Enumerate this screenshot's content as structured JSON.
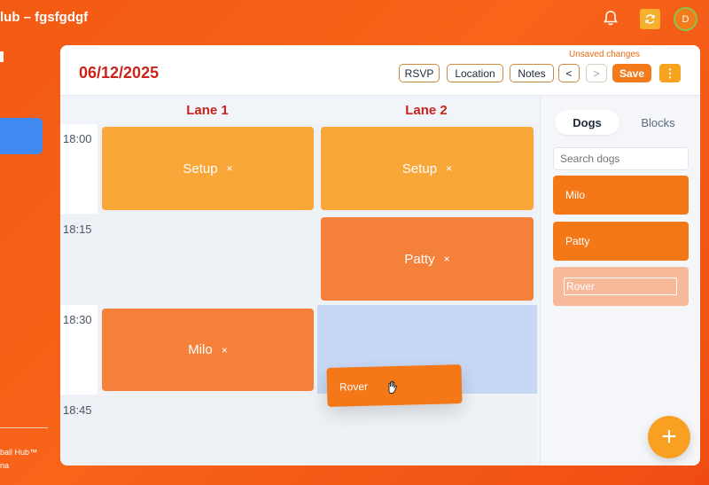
{
  "app": {
    "title": "lub – fgsfgdgf",
    "avatar_initial": "D"
  },
  "sidebar": {
    "footer_line1": "ball Hub™",
    "footer_line2": "na"
  },
  "schedule": {
    "date": "06/12/2025",
    "unsaved_text": "Unsaved changes",
    "toolbar": {
      "rsvp": "RSVP",
      "location": "Location",
      "notes": "Notes",
      "prev": "<",
      "next": ">",
      "save": "Save",
      "more": "⋮"
    },
    "lanes": [
      "Lane 1",
      "Lane 2"
    ],
    "times": [
      "18:00",
      "18:15",
      "18:30",
      "18:45"
    ],
    "events": {
      "lane1_setup": "Setup",
      "lane2_setup": "Setup",
      "lane2_patty": "Patty",
      "lane1_milo": "Milo",
      "remove_symbol": "×"
    },
    "drag_chip": "Rover"
  },
  "panel": {
    "tabs": [
      "Dogs",
      "Blocks"
    ],
    "search_placeholder": "Search dogs",
    "dogs": [
      "Milo",
      "Patty",
      "Rover"
    ]
  },
  "fab": "+",
  "colors": {
    "accent": "#f47718",
    "date": "#c9231a",
    "setup": "#f9a739",
    "drop_target": "#c7d8f4"
  }
}
